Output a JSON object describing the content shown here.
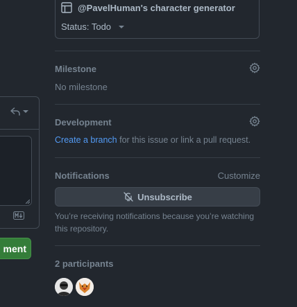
{
  "project": {
    "title": "@PavelHuman's character generator",
    "status_label": "Status: Todo"
  },
  "milestone": {
    "heading": "Milestone",
    "value": "No milestone"
  },
  "development": {
    "heading": "Development",
    "link_text": "Create a branch",
    "suffix_text": " for this issue or link a pull request."
  },
  "notifications": {
    "heading": "Notifications",
    "customize_label": "Customize",
    "unsubscribe_label": "Unsubscribe",
    "description": "You’re receiving notifications because you’re watching this repository."
  },
  "participants": {
    "heading": "2 participants",
    "avatars": [
      "participant-avatar-1",
      "participant-avatar-2"
    ]
  },
  "comment_form": {
    "submit_label": "ment"
  },
  "colors": {
    "background": "#22272e",
    "border": "#444c56",
    "muted_text": "#768390",
    "link": "#539bf5",
    "primary_button": "#347d39"
  },
  "icons": {
    "project": "table-icon",
    "gear": "gear-icon",
    "bell_slash": "bell-slash-icon",
    "reply": "reply-icon",
    "markdown": "markdown-icon"
  }
}
